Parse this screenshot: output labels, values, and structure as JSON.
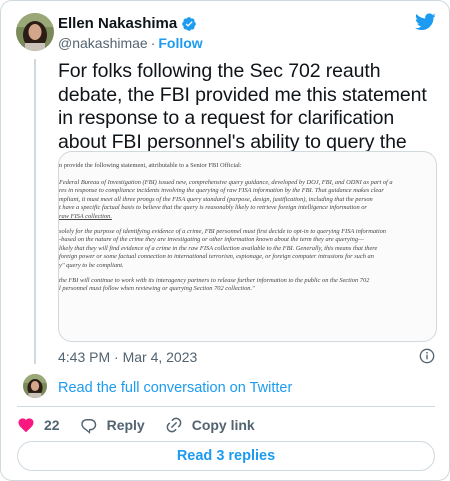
{
  "header": {
    "name": "Ellen Nakashima",
    "handle": "@nakashimae",
    "separator": "·",
    "follow_label": "Follow"
  },
  "tweet": {
    "text": "For folks following the Sec 702 reauth debate, the FBI provided me this statement in response to a request for clarification about FBI personnel's ability to query the database:",
    "timestamp": "4:43 PM · Mar 4, 2023"
  },
  "media": {
    "line1": "n provide the following statement, attributable to a Senior FBI Official:",
    "para1": "Federal Bureau of Investigation (FBI) issued new, comprehensive query guidance, developed by DOJ, FBI, and ODNI as part of a\nres in response to compliance incidents involving the querying of raw FISA information by the FBI. That guidance makes clear\nmpliant, it must meet all three prongs of the FISA query standard (purpose, design, justification), including that the person\nt have a specific factual basis to believe that the query is reasonably likely to retrieve foreign intelligence information or",
    "para1_link": "raw FISA collection.",
    "para2": "solely for the purpose of identifying evidence of a crime, FBI personnel must first decide to opt-in to querying FISA information\n-based on the nature of the crime they are investigating or other information known about the term they are querying—\nlikely that they will find evidence of a crime in the raw FISA collection available to the FBI.  Generally, this means that there\nforeign power or some factual connection to international terrorism, espionage, or foreign computer intrusions for such an\ny\" query to be compliant.",
    "para3": "the FBI will continue to work with its interagency partners to release further information to the public on the Section 702\nl personnel must follow when reviewing or querying Section 702 collection.\""
  },
  "read_full_label": "Read the full conversation on Twitter",
  "actions": {
    "like_count": "22",
    "reply_label": "Reply",
    "copy_link_label": "Copy link"
  },
  "replies_button_label": "Read 3 replies",
  "colors": {
    "accent": "#1d9bf0",
    "like": "#f91880",
    "text": "#0f1419",
    "secondary": "#536471",
    "border": "#cfd9de"
  },
  "icons": [
    "verified-badge-icon",
    "twitter-bird-icon",
    "info-icon",
    "heart-icon",
    "reply-icon",
    "link-icon"
  ]
}
